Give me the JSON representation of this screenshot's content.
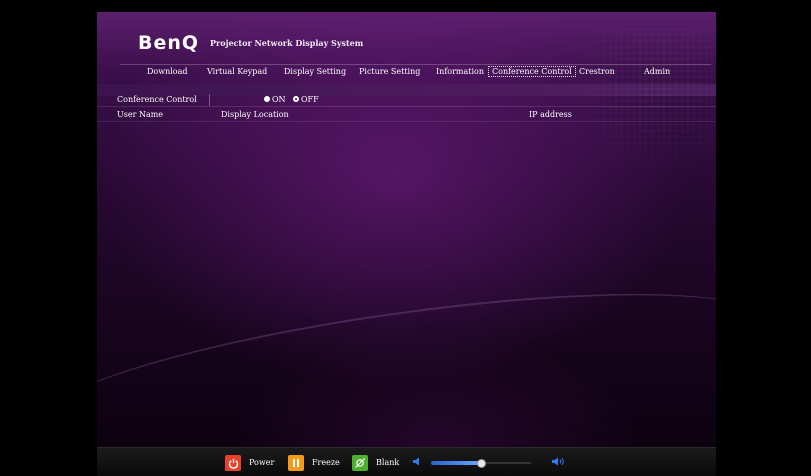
{
  "brand": {
    "logo": "BenQ",
    "system_title": "Projector Network Display System"
  },
  "nav": {
    "items": [
      {
        "label": "Download"
      },
      {
        "label": "Virtual Keypad"
      },
      {
        "label": "Display Setting"
      },
      {
        "label": "Picture Setting"
      },
      {
        "label": "Information"
      },
      {
        "label": "Conference Control",
        "active": true
      },
      {
        "label": "Crestron"
      },
      {
        "label": "Admin"
      }
    ]
  },
  "conference": {
    "label": "Conference Control",
    "on_label": "ON",
    "off_label": "OFF",
    "selected": "OFF"
  },
  "table": {
    "headers": [
      "User Name",
      "Display Location",
      "IP address"
    ]
  },
  "controls": {
    "power_label": "Power",
    "freeze_label": "Freeze",
    "blank_label": "Blank",
    "volume_level": 0.5
  },
  "colors": {
    "power": "#e8412c",
    "freeze": "#f39a1a",
    "blank": "#4caf2e",
    "volume_icon": "#2f7cf0"
  }
}
